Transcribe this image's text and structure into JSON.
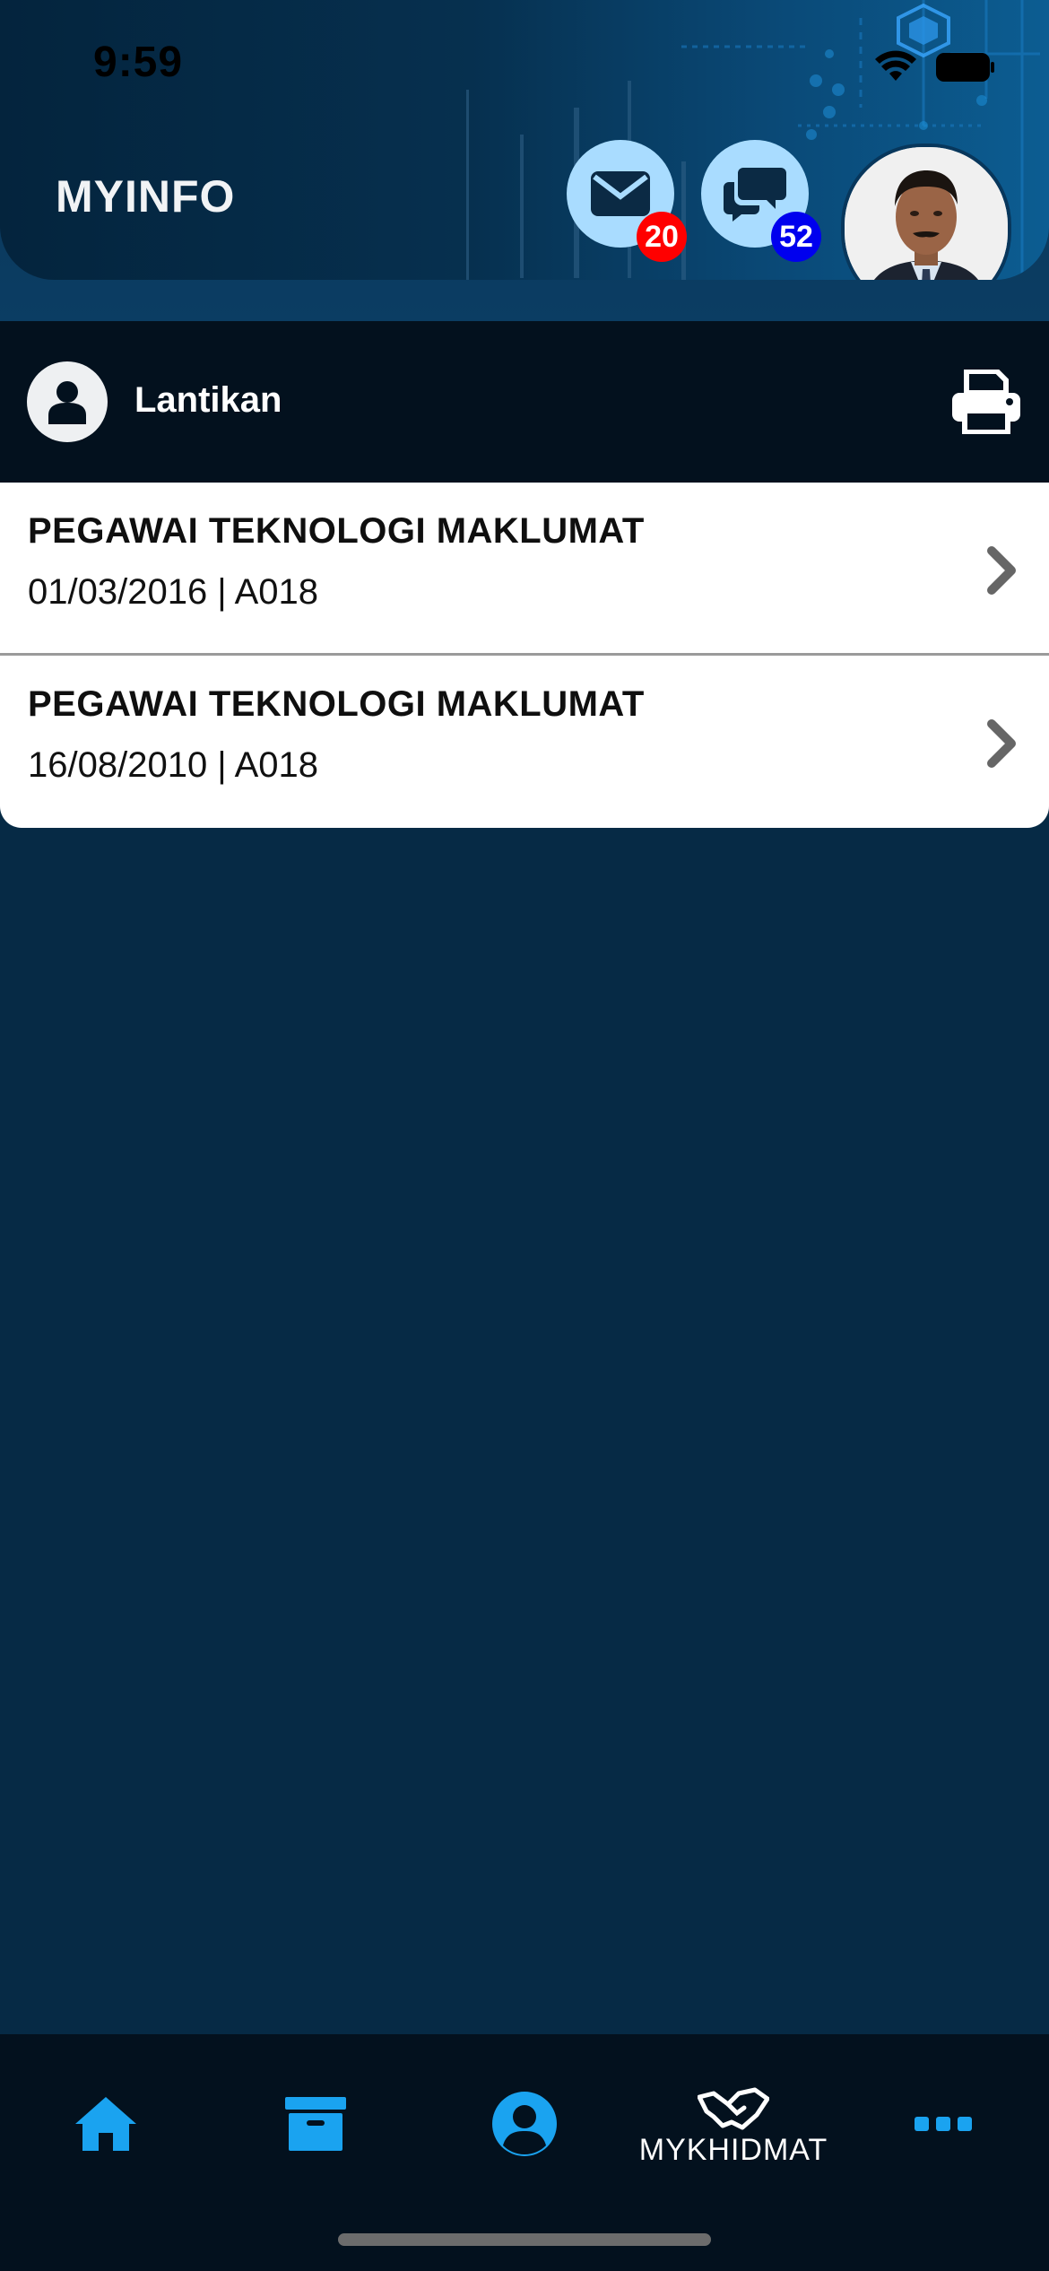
{
  "status_bar": {
    "time": "9:59",
    "wifi_icon": "wifi-icon",
    "battery_icon": "battery-icon"
  },
  "header": {
    "title": "MYINFO",
    "mail": {
      "icon": "mail-icon",
      "count": "20",
      "badge_color": "#ff0000"
    },
    "chat": {
      "icon": "chat-icon",
      "count": "52",
      "badge_color": "#0000ee"
    },
    "avatar_icon": "user-photo"
  },
  "section": {
    "icon": "user-icon",
    "title": "Lantikan",
    "print_icon": "printer-icon"
  },
  "appointments": [
    {
      "title": "PEGAWAI TEKNOLOGI MAKLUMAT",
      "subtitle": "01/03/2016 | A018"
    },
    {
      "title": "PEGAWAI TEKNOLOGI MAKLUMAT",
      "subtitle": "16/08/2010 | A018"
    }
  ],
  "bottom_nav": {
    "home_icon": "home-icon",
    "archive_icon": "archive-icon",
    "profile_icon": "profile-icon",
    "mykhidmat_label": "MYKHIDMAT",
    "more_icon": "more-icon"
  },
  "colors": {
    "accent": "#1aa3f0",
    "header_dark": "#03111e",
    "background": "#062a45",
    "icon_bubble": "#a9dcff"
  }
}
